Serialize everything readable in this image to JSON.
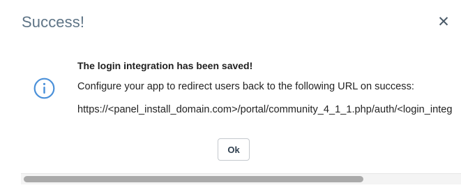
{
  "dialog": {
    "title": "Success!",
    "close_icon": "close-icon",
    "icon": "info-icon",
    "accent_color": "#4a90d9",
    "saved_message": "The login integration has been saved!",
    "instruction": "Configure your app to redirect users back to the following URL on success:",
    "redirect_url": "https://<panel_install_domain.com>/portal/community_4_1_1.php/auth/<login_integ",
    "ok_label": "Ok"
  }
}
